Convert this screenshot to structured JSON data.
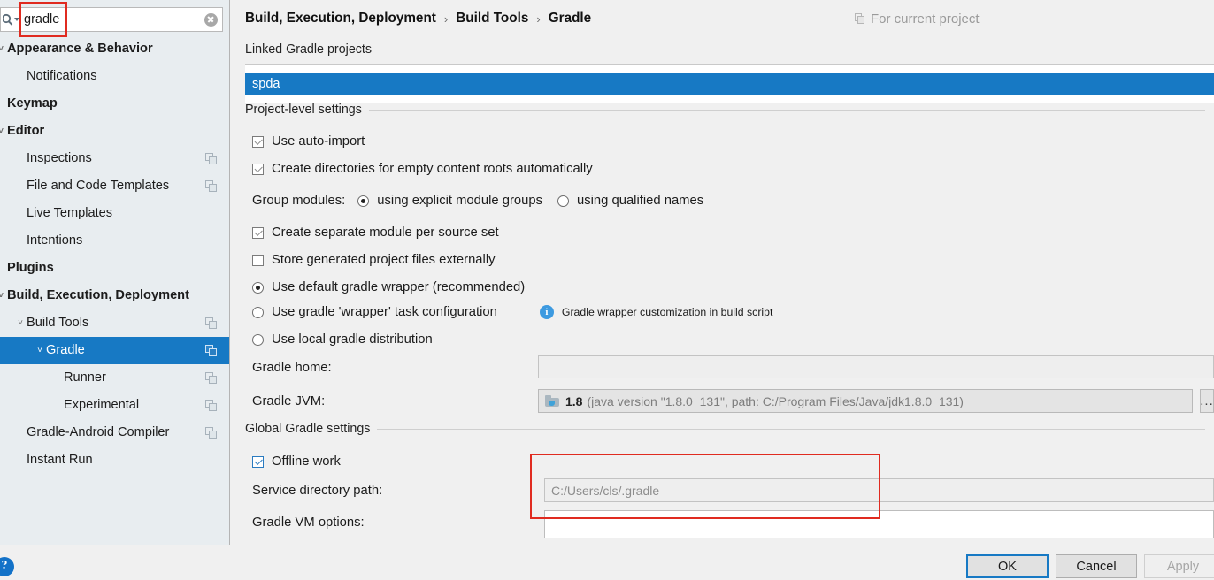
{
  "search": {
    "value": "gradle",
    "placeholder": "",
    "icons": {
      "search": "search-icon",
      "clear": "clear-icon"
    }
  },
  "sidebar": {
    "items": [
      {
        "label": "Appearance & Behavior",
        "indent": 0,
        "bold": true,
        "arrow": "˅",
        "copy": false,
        "selected": false
      },
      {
        "label": "Notifications",
        "indent": 1,
        "bold": false,
        "arrow": "",
        "copy": false,
        "selected": false
      },
      {
        "label": "Keymap",
        "indent": 0,
        "bold": true,
        "arrow": "",
        "copy": false,
        "selected": false
      },
      {
        "label": "Editor",
        "indent": 0,
        "bold": true,
        "arrow": "˅",
        "copy": false,
        "selected": false
      },
      {
        "label": "Inspections",
        "indent": 1,
        "bold": false,
        "arrow": "",
        "copy": true,
        "selected": false
      },
      {
        "label": "File and Code Templates",
        "indent": 1,
        "bold": false,
        "arrow": "",
        "copy": true,
        "selected": false
      },
      {
        "label": "Live Templates",
        "indent": 1,
        "bold": false,
        "arrow": "",
        "copy": false,
        "selected": false
      },
      {
        "label": "Intentions",
        "indent": 1,
        "bold": false,
        "arrow": "",
        "copy": false,
        "selected": false
      },
      {
        "label": "Plugins",
        "indent": 0,
        "bold": true,
        "arrow": "",
        "copy": false,
        "selected": false
      },
      {
        "label": "Build, Execution, Deployment",
        "indent": 0,
        "bold": true,
        "arrow": "˅",
        "copy": false,
        "selected": false
      },
      {
        "label": "Build Tools",
        "indent": 1,
        "bold": false,
        "arrow": "˅",
        "copy": true,
        "selected": false
      },
      {
        "label": "Gradle",
        "indent": 2,
        "bold": false,
        "arrow": "˅",
        "copy": true,
        "selected": true
      },
      {
        "label": "Runner",
        "indent": 3,
        "bold": false,
        "arrow": "",
        "copy": true,
        "selected": false
      },
      {
        "label": "Experimental",
        "indent": 3,
        "bold": false,
        "arrow": "",
        "copy": true,
        "selected": false
      },
      {
        "label": "Gradle-Android Compiler",
        "indent": 1,
        "bold": false,
        "arrow": "",
        "copy": true,
        "selected": false
      },
      {
        "label": "Instant Run",
        "indent": 1,
        "bold": false,
        "arrow": "",
        "copy": false,
        "selected": false
      }
    ]
  },
  "header": {
    "breadcrumb": [
      "Build, Execution, Deployment",
      "Build Tools",
      "Gradle"
    ],
    "separator": "›",
    "for_current_project": "For current project"
  },
  "main": {
    "linked_projects_title": "Linked Gradle projects",
    "linked_projects": [
      "spda"
    ],
    "project_settings_title": "Project-level settings",
    "use_auto_import": "Use auto-import",
    "create_directories": "Create directories for empty content roots automatically",
    "group_modules_label": "Group modules:",
    "group_modules_explicit": "using explicit module groups",
    "group_modules_qualified": "using qualified names",
    "create_separate_module": "Create separate module per source set",
    "store_generated": "Store generated project files externally",
    "wrapper_default": "Use default gradle wrapper (recommended)",
    "wrapper_task": "Use gradle 'wrapper' task configuration",
    "wrapper_local": "Use local gradle distribution",
    "wrapper_info": "Gradle wrapper customization in build script",
    "gradle_home_label": "Gradle home:",
    "gradle_home_value": "",
    "gradle_jvm_label": "Gradle JVM:",
    "gradle_jvm_value_bold": "1.8",
    "gradle_jvm_value_rest": "(java version \"1.8.0_131\", path: C:/Program Files/Java/jdk1.8.0_131)",
    "dots_label": "...",
    "global_settings_title": "Global Gradle settings",
    "offline_work": "Offline work",
    "service_dir_label": "Service directory path:",
    "service_dir_value": "C:/Users/cls/.gradle",
    "vm_options_label": "Gradle VM options:",
    "vm_options_value": ""
  },
  "footer": {
    "ok": "OK",
    "cancel": "Cancel",
    "apply": "Apply",
    "help": "?"
  },
  "colors": {
    "accent": "#1779c4",
    "panel": "#f0f0f0",
    "sidebar": "#e8edf0",
    "annotation": "#e02b20",
    "info": "#3d9ae0"
  }
}
